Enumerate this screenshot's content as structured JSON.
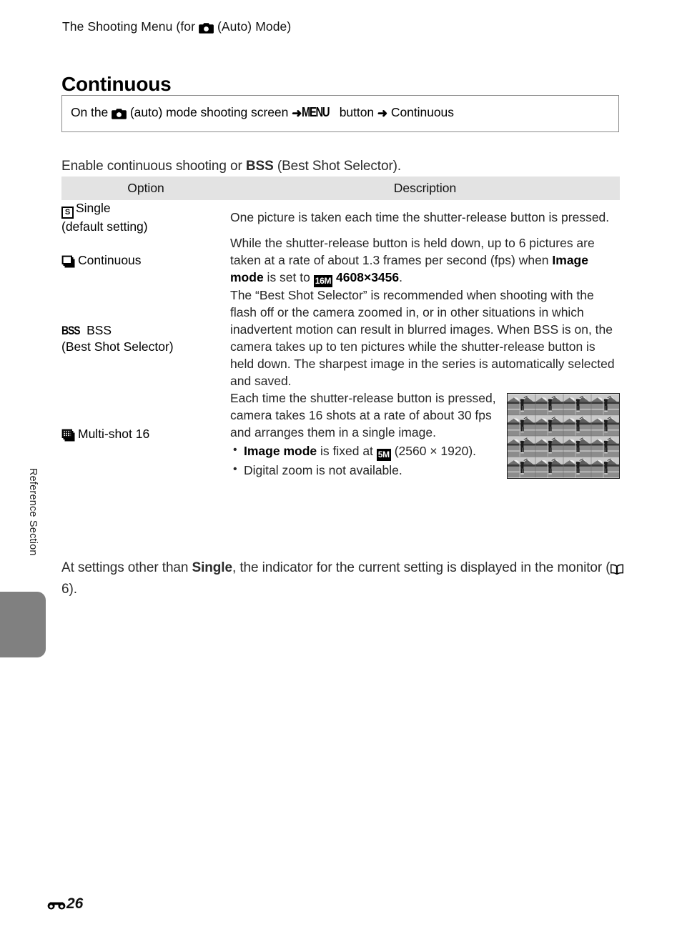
{
  "running_head": {
    "before_icon": "The Shooting Menu (for ",
    "icon": "camera-icon",
    "after_icon": " (Auto) Mode)"
  },
  "page_title": "Continuous",
  "nav_path": {
    "part1": "On the ",
    "icon1": "camera-icon",
    "part2": " (auto) mode shooting screen ",
    "arrow1": "➜",
    "menu_label": "MENU",
    "part3": " button ",
    "arrow2": "➜",
    "part4": " Continuous"
  },
  "intro": {
    "part1": "Enable continuous shooting or ",
    "bold": "BSS",
    "part2": " (Best Shot Selector)."
  },
  "table": {
    "headers": {
      "option": "Option",
      "description": "Description"
    },
    "rows": [
      {
        "icon": "single-frame-icon",
        "option_line1": "Single",
        "option_line2": "(default setting)",
        "description": "One picture is taken each time the shutter-release button is pressed."
      },
      {
        "icon": "stacked-frames-icon",
        "option_line1": "Continuous",
        "option_line2": "",
        "desc_part1": "While the shutter-release button is held down, up to 6 pictures are taken at a rate of about 1.3 frames per second (fps) when ",
        "desc_bold1": "Image mode",
        "desc_part2": " is set to ",
        "image_mode_badge": "16M",
        "desc_bold2": "4608×3456",
        "desc_part3": "."
      },
      {
        "icon": "bss-icon",
        "icon_label": "BSS",
        "option_line1": "BSS",
        "option_line2": "(Best Shot Selector)",
        "description": "The “Best Shot Selector” is recommended when shooting with the flash off or the camera zoomed in, or in other situations in which inadvertent motion can result in blurred images. When BSS is on, the camera takes up to ten pictures while the shutter-release button is held down. The sharpest image in the series is automatically selected and saved."
      },
      {
        "icon": "multi-shot-grid-icon",
        "option_line1": "Multi-shot 16",
        "option_line2": "",
        "desc_intro": "Each time the shutter-release button is pressed, camera takes 16 shots at a rate of about 30 fps and arranges them in a single image.",
        "bullet1_bold": "Image mode",
        "bullet1_part1": " is fixed at ",
        "bullet1_badge": "5M",
        "bullet1_part2": " (2560 × 1920).",
        "bullet2": "Digital zoom is not available.",
        "thumbnail": "multi-shot-16-sample-image"
      }
    ]
  },
  "closing": {
    "part1": "At settings other than ",
    "bold": "Single",
    "part2": ", the indicator for the current setting is displayed in the monitor (",
    "book_icon": "book-icon",
    "page_ref": "6",
    "part3": ")."
  },
  "side_tab": {
    "label": "Reference Section"
  },
  "footer": {
    "mark": "reference-section-mark",
    "page_number": "26"
  }
}
